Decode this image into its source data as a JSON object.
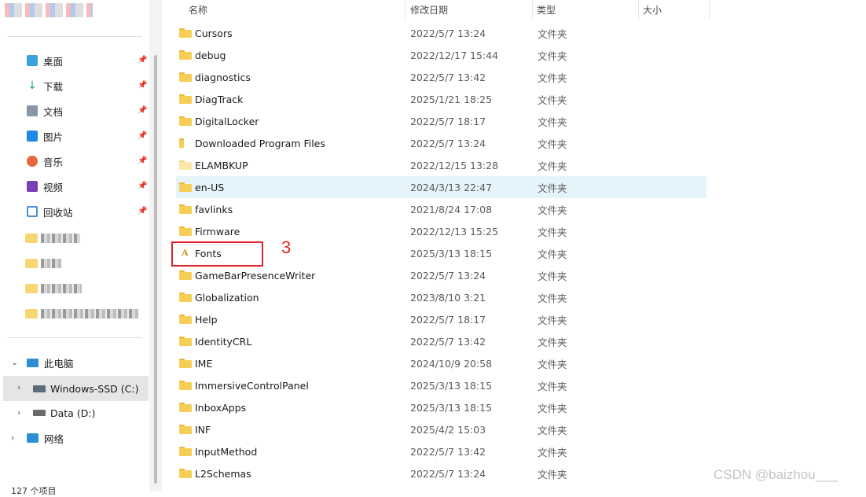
{
  "nav": {
    "quick_access": [
      {
        "label": "桌面",
        "icon": "desktop-icon",
        "color": "#3aa3d9"
      },
      {
        "label": "下载",
        "icon": "download-icon",
        "color": "#2aa86c"
      },
      {
        "label": "文档",
        "icon": "document-icon",
        "color": "#6d7a8a"
      },
      {
        "label": "图片",
        "icon": "pictures-icon",
        "color": "#1e88e5"
      },
      {
        "label": "音乐",
        "icon": "music-icon",
        "color": "#e8663b"
      },
      {
        "label": "视频",
        "icon": "video-icon",
        "color": "#7b3fb8"
      },
      {
        "label": "回收站",
        "icon": "recycle-bin-icon",
        "color": "#4d8fd6"
      }
    ],
    "this_pc": "此电脑",
    "drives": [
      {
        "label": "Windows-SSD (C:)",
        "icon": "drive-c-icon"
      },
      {
        "label": "Data (D:)",
        "icon": "drive-d-icon"
      }
    ],
    "network": "网络",
    "status": "127 个项目"
  },
  "columns": {
    "name": "名称",
    "modified": "修改日期",
    "type": "类型",
    "size": "大小"
  },
  "rows": [
    {
      "name": "Cursors",
      "date": "2022/5/7 13:24",
      "type": "文件夹",
      "icon": "folder-icon"
    },
    {
      "name": "debug",
      "date": "2022/12/17 15:44",
      "type": "文件夹",
      "icon": "folder-icon"
    },
    {
      "name": "diagnostics",
      "date": "2022/5/7 13:42",
      "type": "文件夹",
      "icon": "folder-icon"
    },
    {
      "name": "DiagTrack",
      "date": "2025/1/21 18:25",
      "type": "文件夹",
      "icon": "folder-icon"
    },
    {
      "name": "DigitalLocker",
      "date": "2022/5/7 18:17",
      "type": "文件夹",
      "icon": "folder-icon"
    },
    {
      "name": "Downloaded Program Files",
      "date": "2022/5/7 13:24",
      "type": "文件夹",
      "icon": "special-folder-icon"
    },
    {
      "name": "ELAMBKUP",
      "date": "2022/12/15 13:28",
      "type": "文件夹",
      "icon": "hidden-folder-icon"
    },
    {
      "name": "en-US",
      "date": "2024/3/13 22:47",
      "type": "文件夹",
      "icon": "folder-icon",
      "highlight": true
    },
    {
      "name": "favlinks",
      "date": "2021/8/24 17:08",
      "type": "文件夹",
      "icon": "folder-icon"
    },
    {
      "name": "Firmware",
      "date": "2022/12/13 15:25",
      "type": "文件夹",
      "icon": "folder-icon"
    },
    {
      "name": "Fonts",
      "date": "2025/3/13 18:15",
      "type": "文件夹",
      "icon": "fonts-folder-icon"
    },
    {
      "name": "GameBarPresenceWriter",
      "date": "2022/5/7 13:24",
      "type": "文件夹",
      "icon": "folder-icon"
    },
    {
      "name": "Globalization",
      "date": "2023/8/10 3:21",
      "type": "文件夹",
      "icon": "folder-icon"
    },
    {
      "name": "Help",
      "date": "2022/5/7 18:17",
      "type": "文件夹",
      "icon": "folder-icon"
    },
    {
      "name": "IdentityCRL",
      "date": "2022/5/7 13:42",
      "type": "文件夹",
      "icon": "folder-icon"
    },
    {
      "name": "IME",
      "date": "2024/10/9 20:58",
      "type": "文件夹",
      "icon": "folder-icon"
    },
    {
      "name": "ImmersiveControlPanel",
      "date": "2025/3/13 18:15",
      "type": "文件夹",
      "icon": "folder-icon"
    },
    {
      "name": "InboxApps",
      "date": "2025/3/13 18:15",
      "type": "文件夹",
      "icon": "folder-icon"
    },
    {
      "name": "INF",
      "date": "2025/4/2 15:03",
      "type": "文件夹",
      "icon": "folder-icon"
    },
    {
      "name": "InputMethod",
      "date": "2022/5/7 13:42",
      "type": "文件夹",
      "icon": "folder-icon"
    },
    {
      "name": "L2Schemas",
      "date": "2022/5/7 13:24",
      "type": "文件夹",
      "icon": "folder-icon"
    }
  ],
  "annotation": {
    "label": "3",
    "color": "#e0262a"
  },
  "watermark": "CSDN @baizhou___"
}
